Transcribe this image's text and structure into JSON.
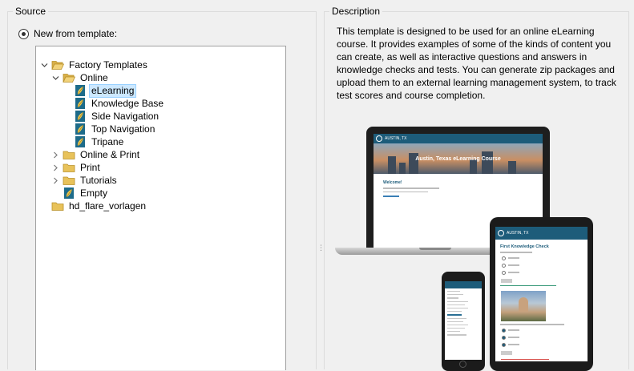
{
  "source": {
    "title": "Source",
    "radio_label": "New from template:",
    "tree": [
      {
        "label": "Factory Templates",
        "level": 0,
        "expanded": true,
        "icon": "folder-open-icon"
      },
      {
        "label": "Online",
        "level": 1,
        "expanded": true,
        "icon": "folder-open-icon"
      },
      {
        "label": "eLearning",
        "level": 2,
        "selected": true,
        "icon": "template-icon"
      },
      {
        "label": "Knowledge Base",
        "level": 2,
        "icon": "template-icon"
      },
      {
        "label": "Side Navigation",
        "level": 2,
        "icon": "template-icon"
      },
      {
        "label": "Top Navigation",
        "level": 2,
        "icon": "template-icon"
      },
      {
        "label": "Tripane",
        "level": 2,
        "icon": "template-icon"
      },
      {
        "label": "Online & Print",
        "level": 1,
        "expanded": false,
        "icon": "folder-icon"
      },
      {
        "label": "Print",
        "level": 1,
        "expanded": false,
        "icon": "folder-icon"
      },
      {
        "label": "Tutorials",
        "level": 1,
        "expanded": false,
        "icon": "folder-icon"
      },
      {
        "label": "Empty",
        "level": 1,
        "icon": "template-icon"
      },
      {
        "label": "hd_flare_vorlagen",
        "level": 0,
        "icon": "folder-icon"
      }
    ]
  },
  "description": {
    "title": "Description",
    "text": "This template is designed to be used for an online eLearning course. It provides examples of some of the kinds of content you can create, as well as interactive questions and answers in knowledge checks and tests. You can generate zip packages and upload them to an external learning management system, to track test scores and course completion.",
    "preview": {
      "site_name": "AUSTIN, TX",
      "hero_title": "Austin, Texas eLearning Course",
      "welcome": "Welcome!",
      "tablet_site_name": "AUSTIN, TX",
      "knowledge_check": "First Knowledge Check"
    }
  },
  "colors": {
    "selection_bg": "#cce8ff",
    "selection_border": "#99d1ff",
    "site_header": "#1d5c7a",
    "folder": "#e8c25a"
  }
}
